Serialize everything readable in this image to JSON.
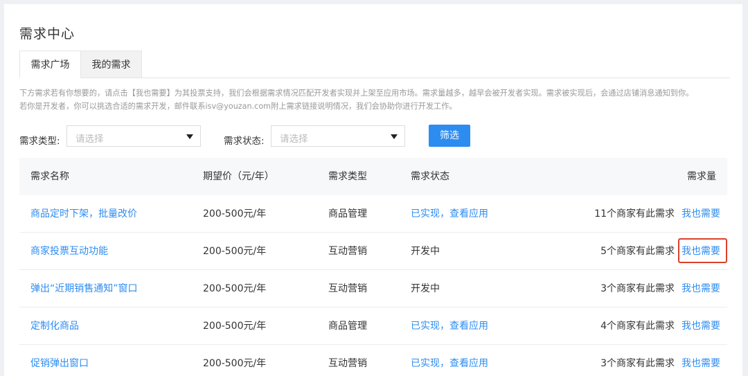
{
  "page": {
    "title": "需求中心"
  },
  "tabs": [
    {
      "label": "需求广场",
      "active": true
    },
    {
      "label": "我的需求",
      "active": false
    }
  ],
  "notice": {
    "line1": "下方需求若有你想要的，请点击【我也需要】为其投票支持，我们会根据需求情况匹配开发者实现并上架至应用市场。需求量越多，越早会被开发者实现。需求被实现后，会通过店铺消息通知到你。",
    "line2": "若你是开发者，你可以挑选合适的需求开发，邮件联系isv@youzan.com附上需求链接说明情况，我们会协助你进行开发工作。"
  },
  "filters": {
    "type_label": "需求类型:",
    "type_placeholder": "请选择",
    "status_label": "需求状态:",
    "status_placeholder": "请选择",
    "button": "筛选"
  },
  "table": {
    "headers": {
      "name": "需求名称",
      "price": "期望价（元/年）",
      "type": "需求类型",
      "status": "需求状态",
      "count": "需求量"
    },
    "rows": [
      {
        "name": "商品定时下架，批量改价",
        "price": "200-500元/年",
        "type": "商品管理",
        "status": "已实现，查看应用",
        "count": "11个商家有此需求",
        "action": "我也需要"
      },
      {
        "name": "商家投票互动功能",
        "price": "200-500元/年",
        "type": "互动营销",
        "status": "开发中",
        "count": "5个商家有此需求",
        "action": "我也需要"
      },
      {
        "name": "弹出“近期销售通知”窗口",
        "price": "200-500元/年",
        "type": "互动营销",
        "status": "开发中",
        "count": "3个商家有此需求",
        "action": "我也需要"
      },
      {
        "name": "定制化商品",
        "price": "200-500元/年",
        "type": "商品管理",
        "status": "已实现，查看应用",
        "count": "4个商家有此需求",
        "action": "我也需要"
      },
      {
        "name": "促销弹出窗口",
        "price": "200-500元/年",
        "type": "互动营销",
        "status": "已实现，查看应用",
        "count": "3个商家有此需求",
        "action": "我也需要"
      }
    ]
  },
  "colors": {
    "accent": "#2d8cf0",
    "highlight_border": "#d9402b"
  }
}
